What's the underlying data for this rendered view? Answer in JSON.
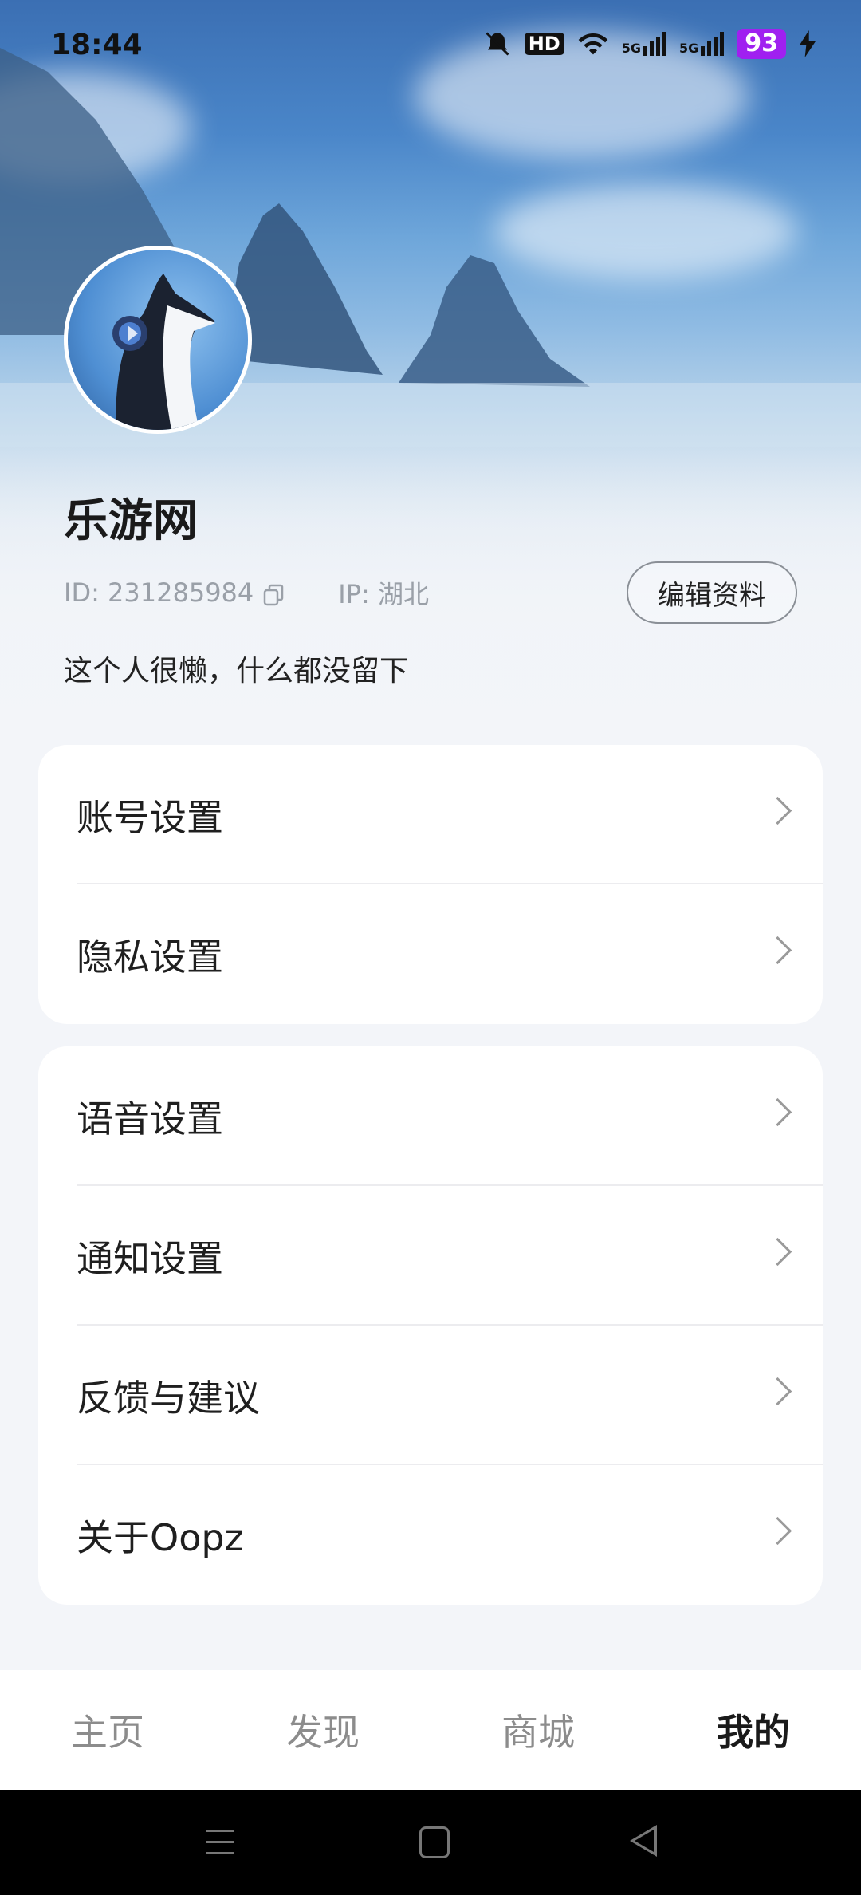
{
  "status_bar": {
    "time": "18:44",
    "hd_label": "HD",
    "signal1_label": "5G",
    "signal2_label": "5G",
    "battery": "93",
    "icons": [
      "bell-muted-icon",
      "hd-icon",
      "wifi-icon",
      "signal-icon",
      "signal-icon",
      "battery-icon",
      "charging-icon"
    ],
    "battery_color": "#a020f0"
  },
  "profile": {
    "username": "乐游网",
    "id_text": "ID: 231285984",
    "ip_text": "IP: 湖北",
    "edit_label": "编辑资料",
    "bio": "这个人很懒，什么都没留下"
  },
  "settings_group1": [
    {
      "label": "账号设置"
    },
    {
      "label": "隐私设置"
    }
  ],
  "settings_group2": [
    {
      "label": "语音设置"
    },
    {
      "label": "通知设置"
    },
    {
      "label": "反馈与建议"
    },
    {
      "label": "关于Oopz"
    }
  ],
  "tabs": [
    {
      "label": "主页",
      "active": false
    },
    {
      "label": "发现",
      "active": false
    },
    {
      "label": "商城",
      "active": false
    },
    {
      "label": "我的",
      "active": true
    }
  ]
}
